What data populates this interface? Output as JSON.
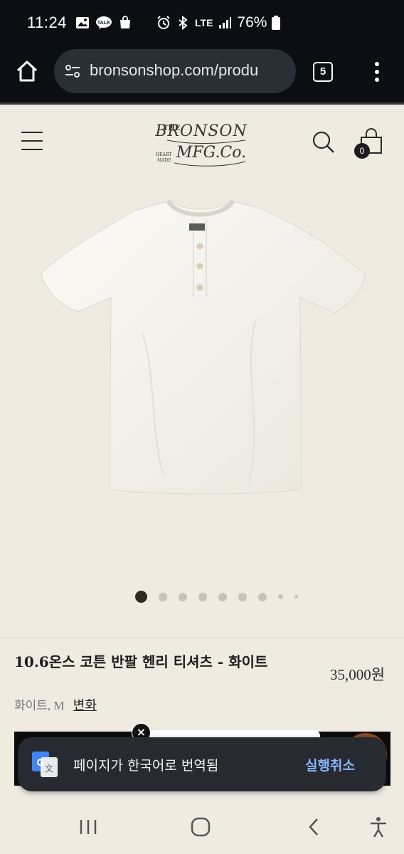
{
  "status_bar": {
    "time": "11:24",
    "left_icons": [
      "gallery-icon",
      "talk-icon",
      "shopping-bag-icon"
    ],
    "right_icons": [
      "alarm-icon",
      "bluetooth-icon",
      "lte-icon",
      "signal-icon"
    ],
    "network": "LTE",
    "battery_percent": "76%",
    "talk_label": "TALK"
  },
  "browser": {
    "url": "bronsonshop.com/produ",
    "tab_count": "5"
  },
  "site_header": {
    "cart_count": "0",
    "logo_text": "THE BRONSON MFG. Co. HEART MADE"
  },
  "product": {
    "title": "10.6온스 코튼 반팔 헨리 티셔츠 - 화이트",
    "price": "35,000원",
    "variant": "화이트, M",
    "variant_change": "변화",
    "image_count": 9,
    "active_image_index": 0
  },
  "translate_toast": {
    "message": "페이지가 한국어로 번역됨",
    "action": "실행취소"
  },
  "close_glyph": "×",
  "colors": {
    "background": "#efebe1",
    "chrome": "#0b0f14",
    "toast": "#272a30",
    "toast_action": "#8ab4f8"
  }
}
